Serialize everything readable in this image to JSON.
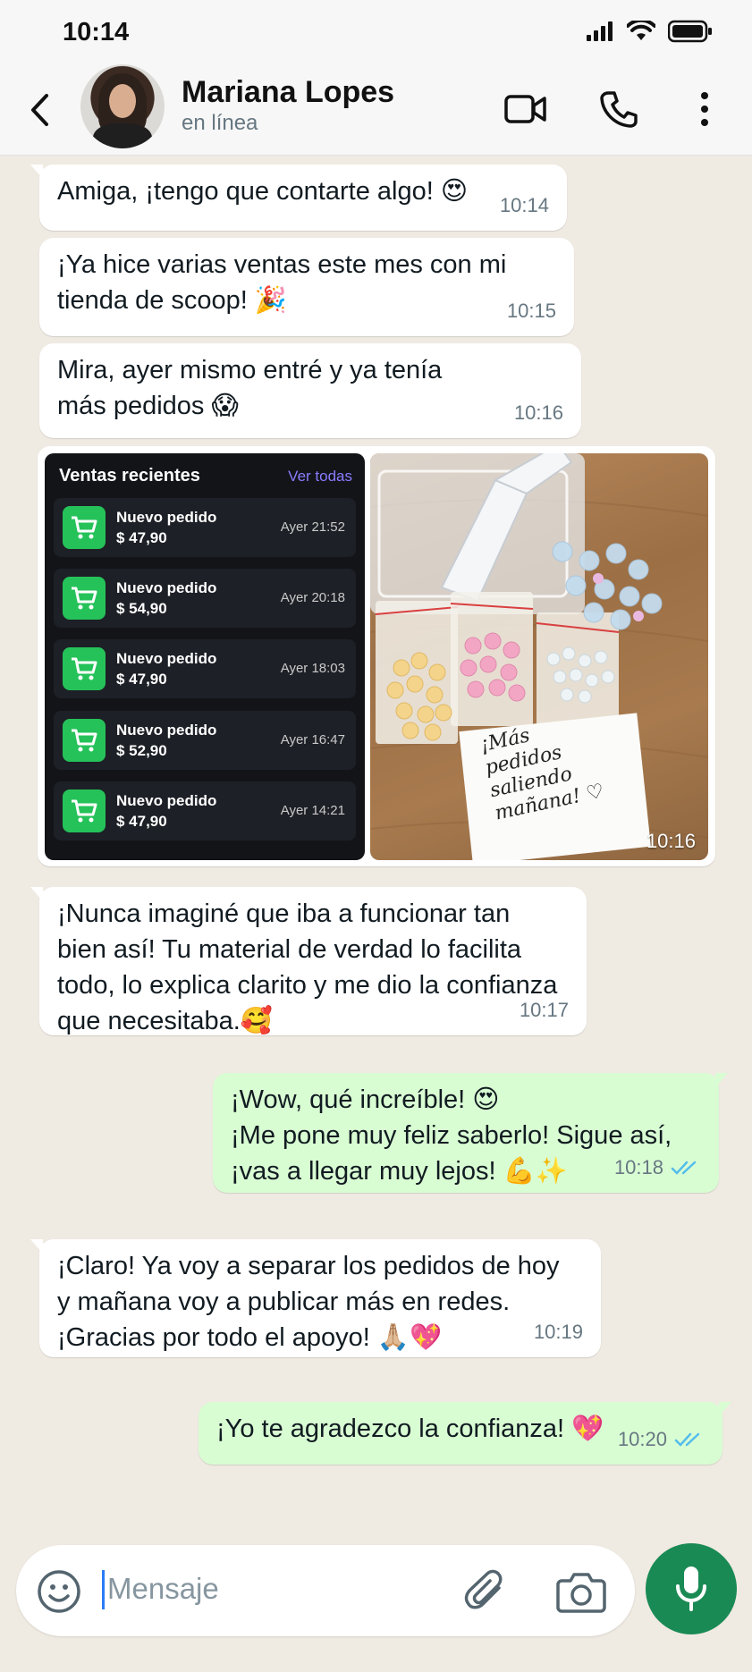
{
  "status_bar": {
    "time": "10:14"
  },
  "header": {
    "contact_name": "Mariana Lopes",
    "contact_status": "en línea"
  },
  "messages": [
    {
      "dir": "in",
      "text": "Amiga, ¡tengo que contarte algo! 😍",
      "time": "10:14"
    },
    {
      "dir": "in",
      "text": "¡Ya hice varias ventas este mes con mi\ntienda de scoop! 🎉",
      "time": "10:15"
    },
    {
      "dir": "in",
      "text": "Mira, ayer mismo entré y ya tenía\nmás pedidos 😱",
      "time": "10:16"
    },
    {
      "dir": "in",
      "text": "¡Nunca imaginé que iba a funcionar tan\nbien así! Tu material de verdad lo facilita\ntodo, lo explica clarito y me dio la confianza\nque necesitaba.🥰",
      "time": "10:17"
    },
    {
      "dir": "out",
      "text": "¡Wow, qué increíble! 😍\n¡Me pone muy feliz saberlo! Sigue así,\n¡vas a llegar muy lejos! 💪✨",
      "time": "10:18"
    },
    {
      "dir": "in",
      "text": "¡Claro! Ya voy a separar los pedidos de hoy\ny mañana voy a publicar más en redes.\n¡Gracias por todo el apoyo! 🙏🏼💖",
      "time": "10:19"
    },
    {
      "dir": "out",
      "text": "¡Yo te agradezco la confianza! 💖",
      "time": "10:20"
    }
  ],
  "image_message": {
    "time": "10:16",
    "sales_panel": {
      "title": "Ventas recientes",
      "link": "Ver todas",
      "orders": [
        {
          "title": "Nuevo pedido",
          "amount": "$ 47,90",
          "time": "Ayer 21:52"
        },
        {
          "title": "Nuevo pedido",
          "amount": "$ 54,90",
          "time": "Ayer 20:18"
        },
        {
          "title": "Nuevo pedido",
          "amount": "$ 47,90",
          "time": "Ayer 18:03"
        },
        {
          "title": "Nuevo pedido",
          "amount": "$ 52,90",
          "time": "Ayer 16:47"
        },
        {
          "title": "Nuevo pedido",
          "amount": "$ 47,90",
          "time": "Ayer 14:21"
        }
      ]
    },
    "photo_note": "¡Más\npedidos\nsaliendo\nmañana! ♡"
  },
  "input": {
    "placeholder": "Mensaje"
  },
  "colors": {
    "chat_bg": "#efeae2",
    "bubble_in": "#ffffff",
    "bubble_out": "#d9fdd3",
    "read_ticks": "#53bdeb",
    "mic_button": "#1a8a55"
  }
}
